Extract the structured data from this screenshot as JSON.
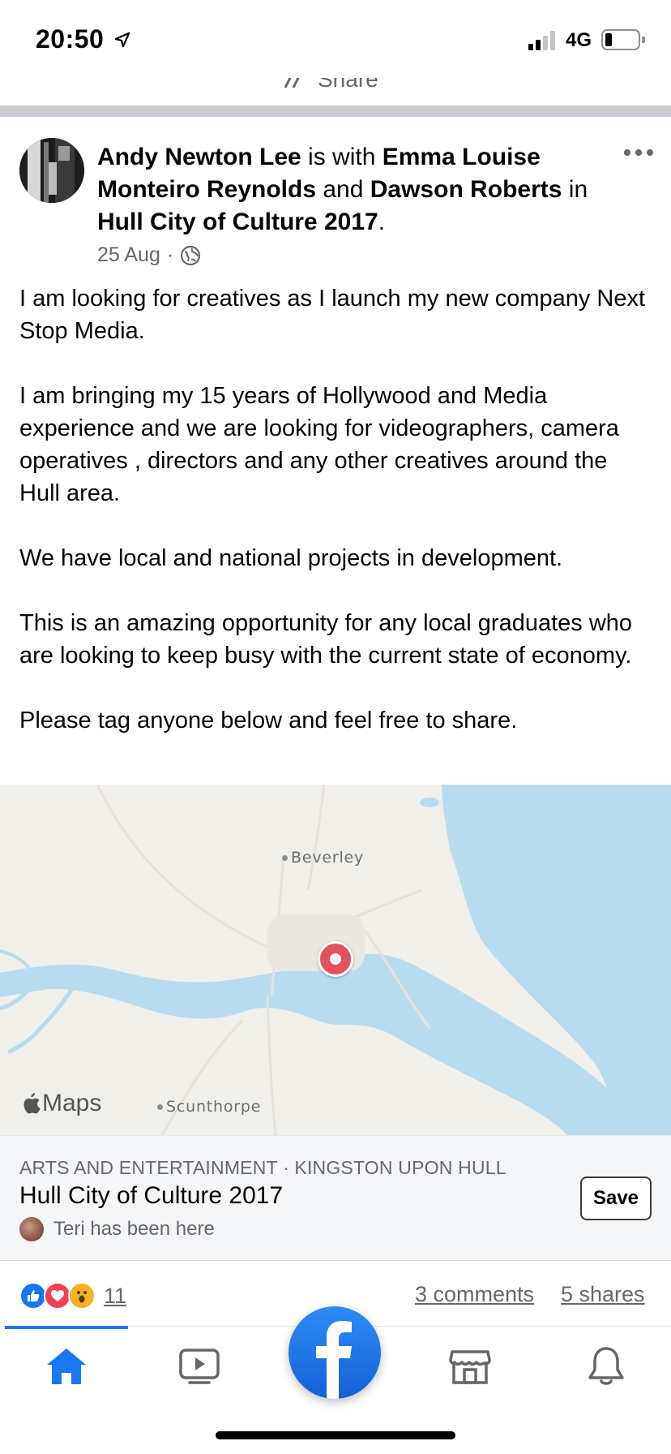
{
  "status_bar": {
    "time": "20:50",
    "network": "4G",
    "icons": [
      "location-arrow-icon",
      "signal-icon",
      "battery-icon"
    ]
  },
  "previous_post": {
    "share_label": "Share"
  },
  "post": {
    "author": "Andy Newton Lee",
    "with_text": " is with ",
    "tagged_1": "Emma Louise Monteiro Reynolds",
    "and_text": " and ",
    "tagged_2": "Dawson Roberts",
    "in_text": " in ",
    "place": "Hull City of Culture 2017",
    "period": ".",
    "date": "25 Aug",
    "separator": "·",
    "audience_icon": "globe-icon",
    "body": [
      "I am looking for creatives as I launch my new company Next Stop Media.",
      "I am bringing my 15 years of Hollywood and Media experience and we are looking for videographers, camera operatives , directors and any other creatives around the Hull area.",
      "We have local and national projects in development.",
      "This is an amazing opportunity for any local graduates who are looking to keep busy with the current state of economy.",
      "Please tag anyone below and feel free to share."
    ]
  },
  "map": {
    "provider": "Maps",
    "places": [
      "Beverley",
      "Scunthorpe"
    ],
    "colors": {
      "land": "#f0efe9",
      "water": "#b7dcf0",
      "pin": "#e3525c"
    }
  },
  "place_card": {
    "category": "ARTS AND ENTERTAINMENT · KINGSTON UPON HULL",
    "name": "Hull City of Culture 2017",
    "visitor_text": "Teri has been here",
    "save_label": "Save"
  },
  "engagement": {
    "reactions": [
      "like",
      "love",
      "wow"
    ],
    "reaction_count": "11",
    "comments": "3 comments",
    "shares": "5 shares"
  },
  "tab_bar": {
    "tabs": [
      "home-icon",
      "watch-icon",
      "facebook-icon",
      "marketplace-icon",
      "notifications-icon"
    ],
    "active": "home",
    "accent": "#1877f2"
  }
}
